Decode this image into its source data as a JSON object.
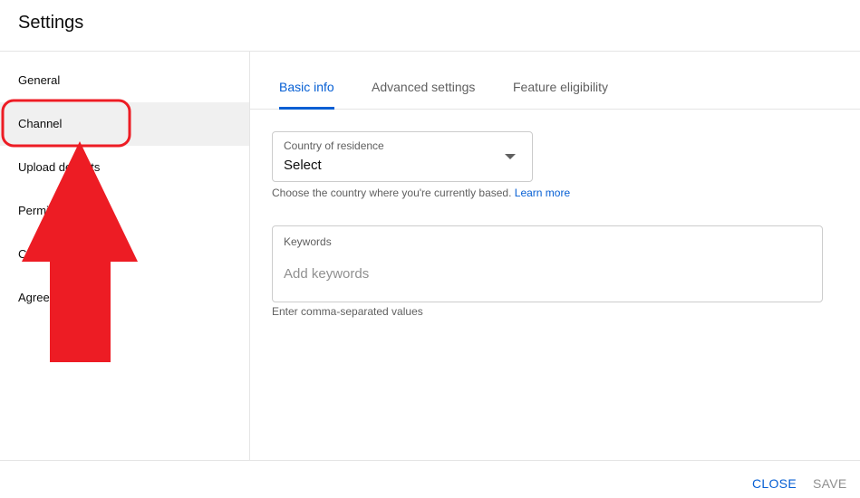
{
  "header": {
    "title": "Settings"
  },
  "sidebar": {
    "items": [
      {
        "label": "General"
      },
      {
        "label": "Channel"
      },
      {
        "label": "Upload defaults"
      },
      {
        "label": "Permissions"
      },
      {
        "label": "Community"
      },
      {
        "label": "Agreements"
      }
    ],
    "selected": "Channel"
  },
  "tabs": [
    {
      "label": "Basic info"
    },
    {
      "label": "Advanced settings"
    },
    {
      "label": "Feature eligibility"
    }
  ],
  "active_tab": "Basic info",
  "country": {
    "label": "Country of residence",
    "value": "Select",
    "helper": "Choose the country where you're currently based.",
    "link": "Learn more"
  },
  "keywords": {
    "label": "Keywords",
    "placeholder": "Add keywords",
    "helper": "Enter comma-separated values"
  },
  "footer": {
    "close_label": "CLOSE",
    "save_label": "SAVE"
  },
  "colors": {
    "accent": "#065fd4",
    "annotation": "#ed1c24",
    "selected_bg": "#f0f0f0"
  },
  "icons": {
    "country_dropdown": "caret-down-icon"
  }
}
